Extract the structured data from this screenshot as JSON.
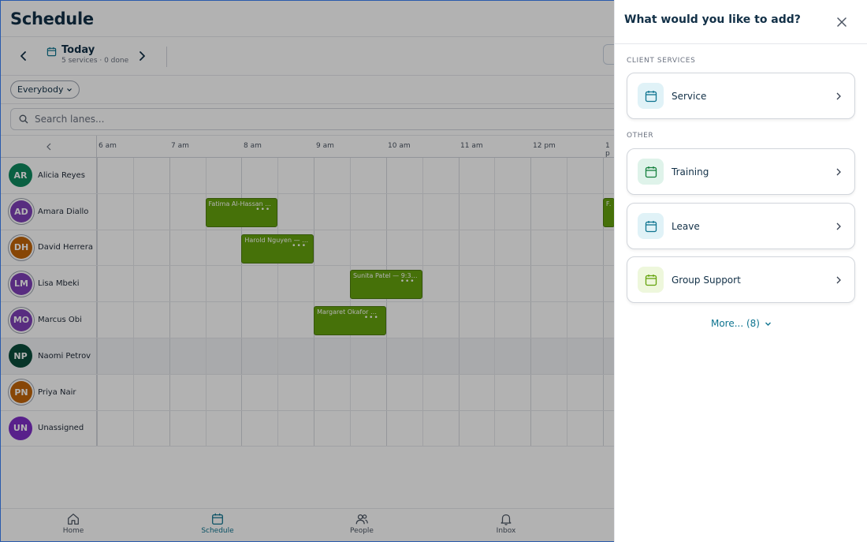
{
  "app": {
    "title": "Schedule",
    "date": {
      "day": "Today",
      "summary": "5 services · 0 done"
    },
    "filter": {
      "label": "Everybody"
    },
    "search": {
      "placeholder": "Search lanes..."
    },
    "hours": [
      "6 am",
      "7 am",
      "8 am",
      "9 am",
      "10 am",
      "11 am",
      "12 pm",
      "1 p"
    ],
    "lanes": [
      {
        "initials": "AR",
        "name": "Alicia Reyes",
        "color": "#0f8a5f",
        "ring": false
      },
      {
        "initials": "AD",
        "name": "Amara Diallo",
        "color": "#7e3fb8",
        "ring": true
      },
      {
        "initials": "DH",
        "name": "David Herrera",
        "color": "#c2650a",
        "ring": true
      },
      {
        "initials": "LM",
        "name": "Lisa Mbeki",
        "color": "#7e3fb8",
        "ring": true
      },
      {
        "initials": "MO",
        "name": "Marcus Obi",
        "color": "#7e3fb8",
        "ring": true
      },
      {
        "initials": "NP",
        "name": "Naomi Petrov",
        "color": "#0b4d3c",
        "ring": false
      },
      {
        "initials": "PN",
        "name": "Priya Nair",
        "color": "#c2650a",
        "ring": true
      },
      {
        "initials": "UN",
        "name": "Unassigned",
        "color": "#7e2fc8",
        "ring": false
      }
    ],
    "events": [
      {
        "lane": 1,
        "title": "Fatima Al-Hassan ...",
        "start": "7:30",
        "end": "8:30"
      },
      {
        "lane": 1,
        "title": "Fat",
        "start": "13:00",
        "end": "14:00"
      },
      {
        "lane": 2,
        "title": "Harold Nguyen — 8...",
        "start": "8:00",
        "end": "9:00"
      },
      {
        "lane": 3,
        "title": "Sunita Patel — 9:30...",
        "start": "9:30",
        "end": "10:30"
      },
      {
        "lane": 4,
        "title": "Margaret Okafor — ...",
        "start": "9:00",
        "end": "10:00"
      }
    ],
    "event_more": "•••",
    "nav": [
      {
        "label": "Home",
        "icon": "home-icon",
        "active": false
      },
      {
        "label": "Schedule",
        "icon": "calendar-icon",
        "active": true
      },
      {
        "label": "People",
        "icon": "people-icon",
        "active": false
      },
      {
        "label": "Inbox",
        "icon": "bell-icon",
        "active": false
      }
    ]
  },
  "drawer": {
    "title": "What would you like to add?",
    "section_client": "CLIENT SERVICES",
    "section_other": "OTHER",
    "options": [
      {
        "label": "Service",
        "icon_bg": "#e0f2f7",
        "icon_color": "#0e7490"
      },
      {
        "label": "Training",
        "icon_bg": "#dff3ea",
        "icon_color": "#15803d"
      },
      {
        "label": "Leave",
        "icon_bg": "#e0f2f7",
        "icon_color": "#0e7490"
      },
      {
        "label": "Group Support",
        "icon_bg": "#eef7dc",
        "icon_color": "#65a30d"
      }
    ],
    "more_label": "More... (8)"
  }
}
